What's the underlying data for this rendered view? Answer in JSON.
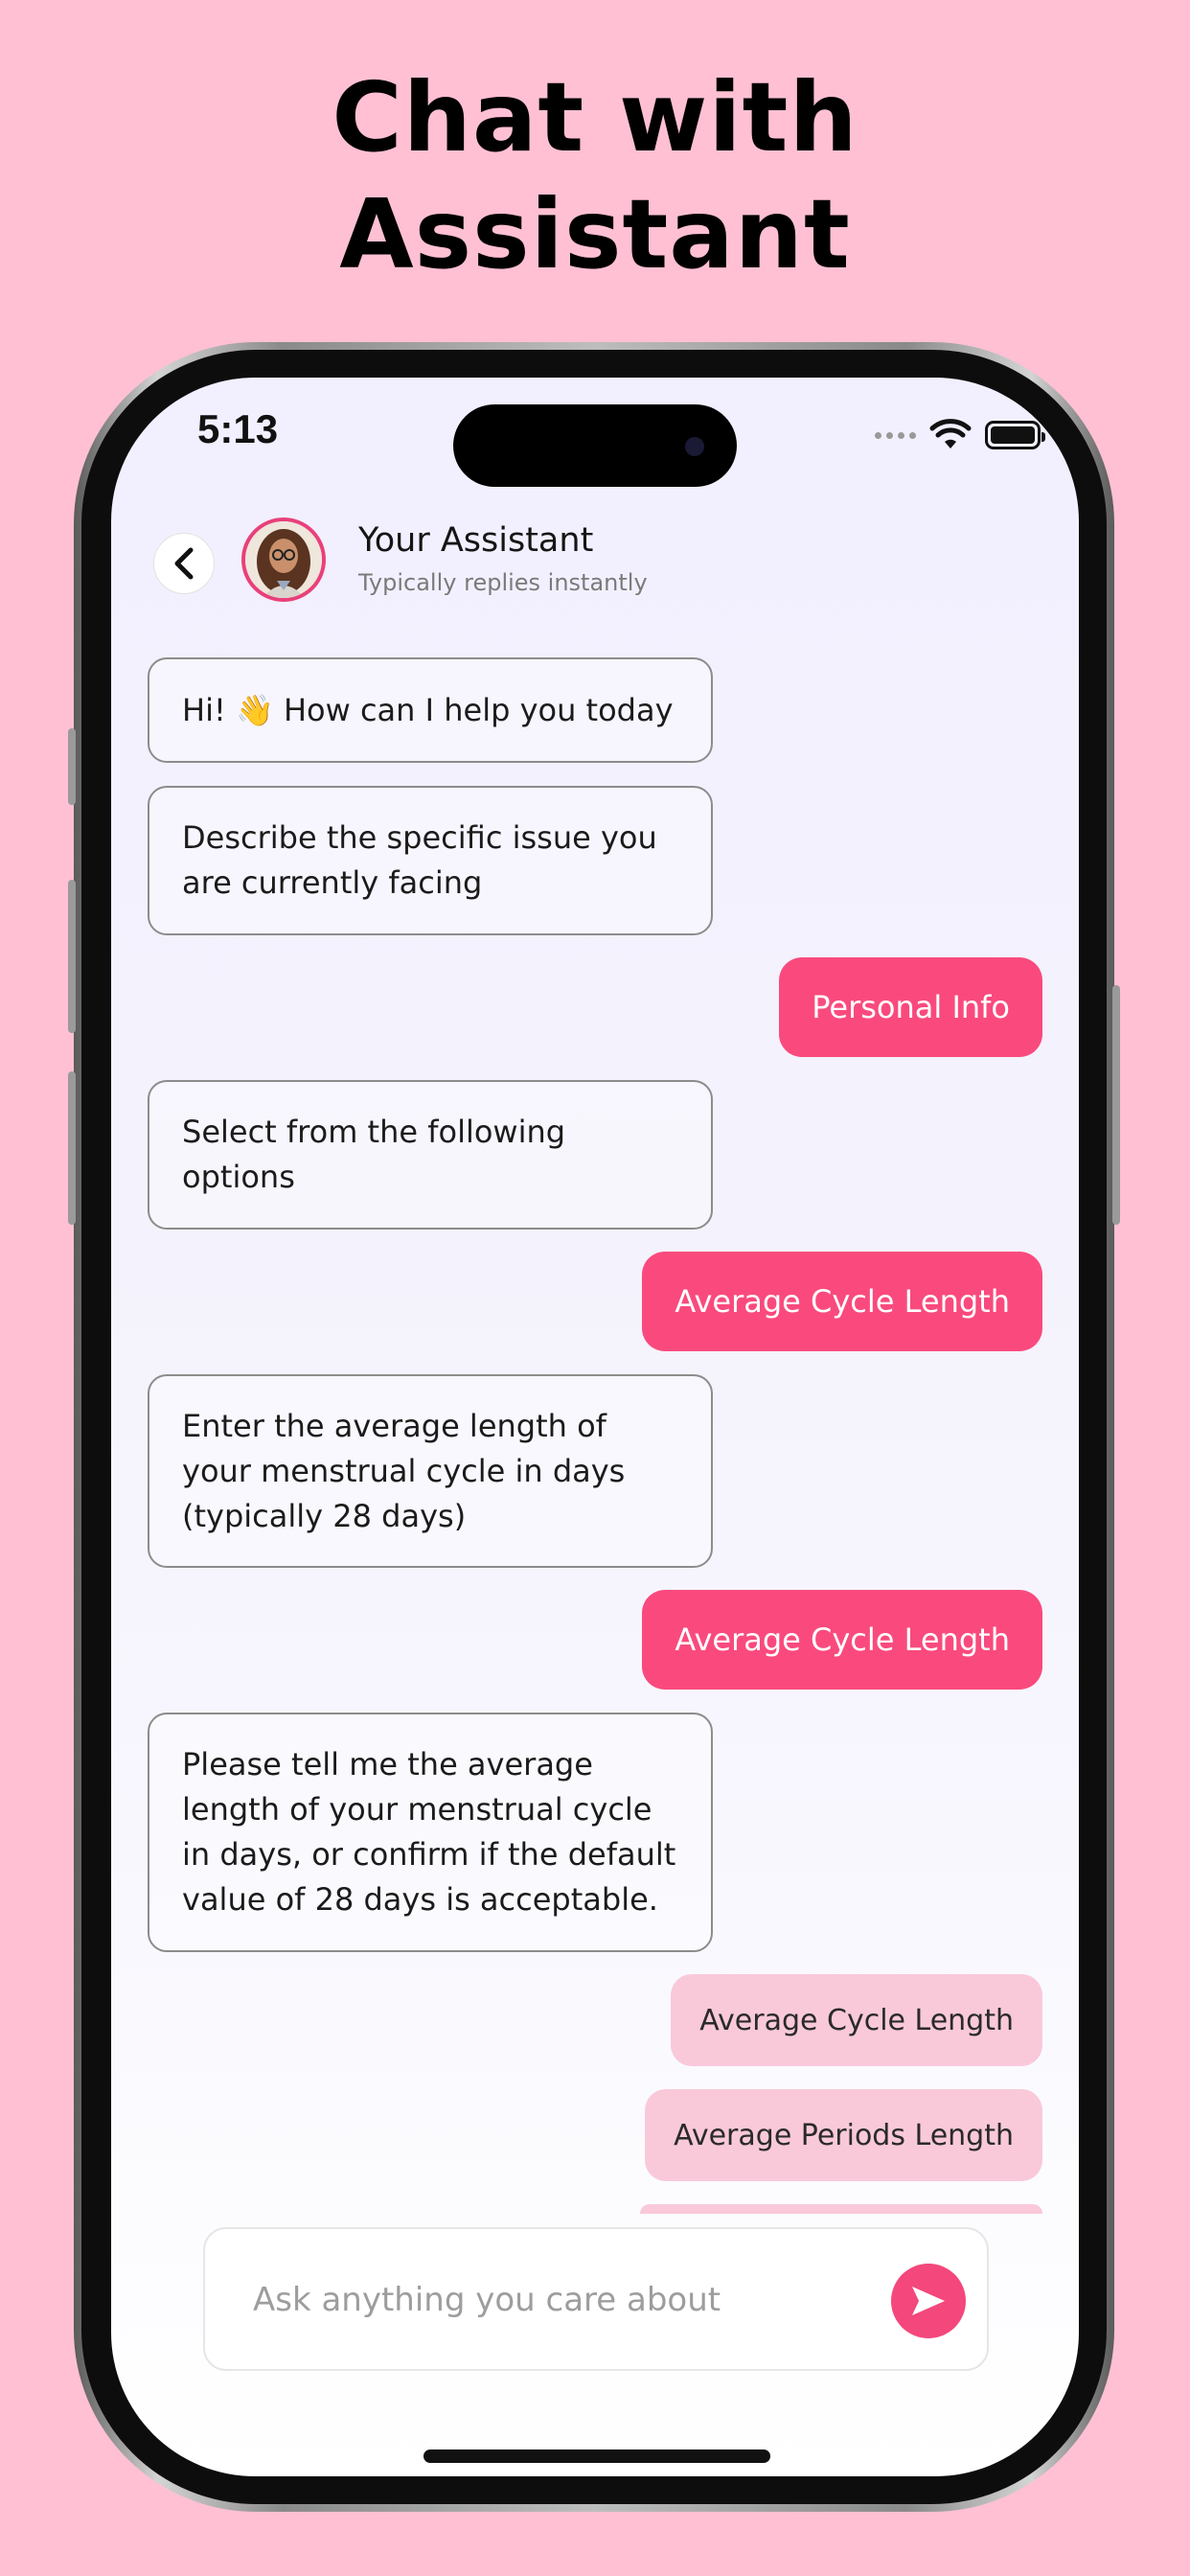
{
  "headline": {
    "line1": "Chat with",
    "line2": "Assistant"
  },
  "status_bar": {
    "time": "5:13"
  },
  "header": {
    "name": "Your Assistant",
    "subtitle": "Typically replies instantly"
  },
  "messages": {
    "m1": "Hi! 👋  How can I help you today",
    "m2": "Describe the specific issue you are currently facing",
    "r1": "Personal Info",
    "m3": "Select from the following options",
    "r2": "Average Cycle Length",
    "m4": "Enter the average length of your menstrual cycle in days (typically 28 days)",
    "r3": "Average Cycle Length",
    "m5": "Please tell me the average length of your menstrual cycle in days, or confirm if the default value of 28 days is acceptable."
  },
  "options": [
    "Average Cycle Length",
    "Average Periods Length"
  ],
  "input": {
    "placeholder": "Ask anything you care about"
  },
  "colors": {
    "accent": "#FA4A7D",
    "option_bg": "#F9C9DA",
    "background": "#FFC0D3"
  }
}
